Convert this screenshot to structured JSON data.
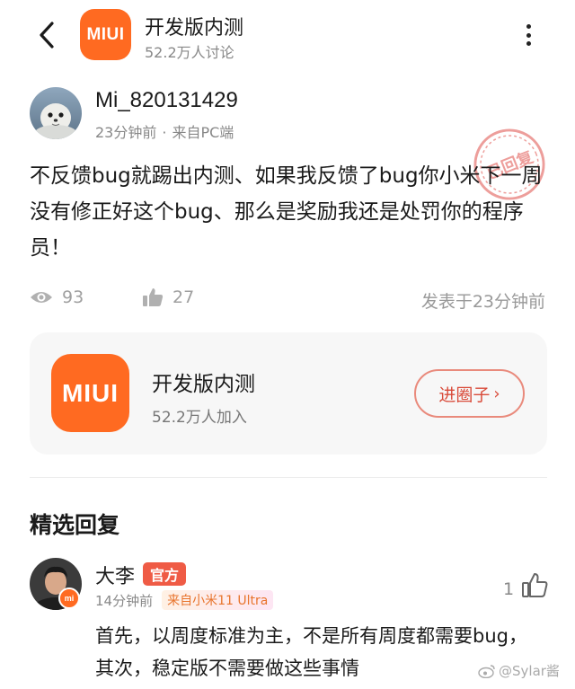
{
  "header": {
    "logo_text": "MIUI",
    "title": "开发版内测",
    "subtitle": "52.2万人讨论",
    "back_icon": "chevron-left-icon",
    "more_icon": "more-vertical-icon"
  },
  "post": {
    "author": "Mi_820131429",
    "time": "23分钟前",
    "separator": "·",
    "source": "来自PC端",
    "stamp_text": "已回复",
    "body": "不反馈bug就踢出内测、如果我反馈了bug你小米下一周没有修正好这个bug、那么是奖励我还是处罚你的程序员！",
    "views": "93",
    "likes": "27",
    "posted_at": "发表于23分钟前"
  },
  "circle": {
    "logo_text": "MIUI",
    "title": "开发版内测",
    "members": "52.2万人加入",
    "enter_label": "进圈子",
    "enter_chevron": "›"
  },
  "replies_section": {
    "title": "精选回复"
  },
  "reply": {
    "author": "大李",
    "badge": "官方",
    "avatar_badge": "mi",
    "time": "14分钟前",
    "device": "来自小米11 Ultra",
    "likes": "1",
    "body": "首先，以周度标准为主，不是所有周度都需要bug，其次，稳定版不需要做这些事情"
  },
  "watermark": "@Sylar酱",
  "colors": {
    "brand_orange": "#ff6a21",
    "official_red": "#ef5b45",
    "stamp_red": "#e0504a",
    "text_primary": "#1a1a1a",
    "text_secondary": "#888888"
  }
}
